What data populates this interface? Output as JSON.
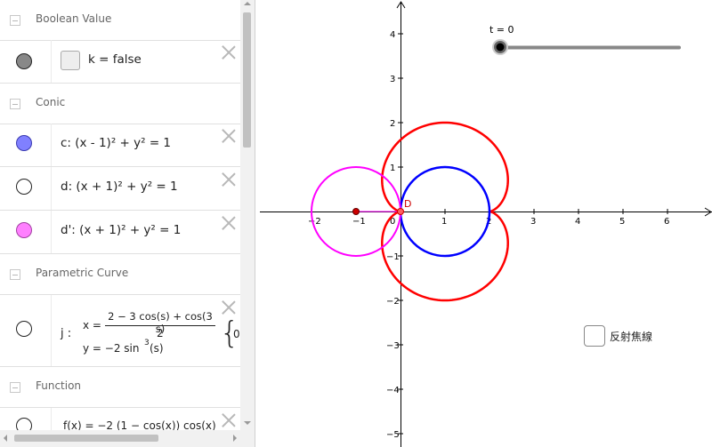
{
  "groups": {
    "boolean": "Boolean Value",
    "conic": "Conic",
    "parametric": "Parametric Curve",
    "function": "Function"
  },
  "rows": {
    "k": {
      "text": "k = false",
      "marker_color": "#888888"
    },
    "c": {
      "text": "c: (x - 1)² + y² = 1",
      "marker_color": "#8080ff"
    },
    "d": {
      "text": "d: (x + 1)² + y² = 1",
      "marker_color": "#ffffff"
    },
    "d2": {
      "text": "d': (x + 1)² + y² = 1",
      "marker_color": "#ff80ff"
    },
    "j": {
      "name": "j :",
      "x_lhs": "x =",
      "x_num": "2 − 3  cos(s) + cos(3 s)",
      "x_den": "2",
      "y_eq": "y = −2  sin",
      "y_exp": "3",
      "y_arg": "(s)",
      "range_start": "0"
    },
    "f": {
      "text": "f(x)  =  −2 (1 − cos(x))  cos(x)"
    }
  },
  "graphics": {
    "slider_label": "t = 0",
    "point_label": "D",
    "checkbox_label": "反射焦線",
    "x_ticks": [
      "−2",
      "−1",
      "0",
      "1",
      "2",
      "3",
      "4",
      "5",
      "6"
    ],
    "y_ticks": [
      "4",
      "3",
      "2",
      "1",
      "−1",
      "−2",
      "−3",
      "−4",
      "−5"
    ],
    "colors": {
      "cardioid": "#ff0000",
      "circle_c": "#0000ff",
      "circle_d2": "#ff00ff",
      "slider": "#888888"
    }
  }
}
